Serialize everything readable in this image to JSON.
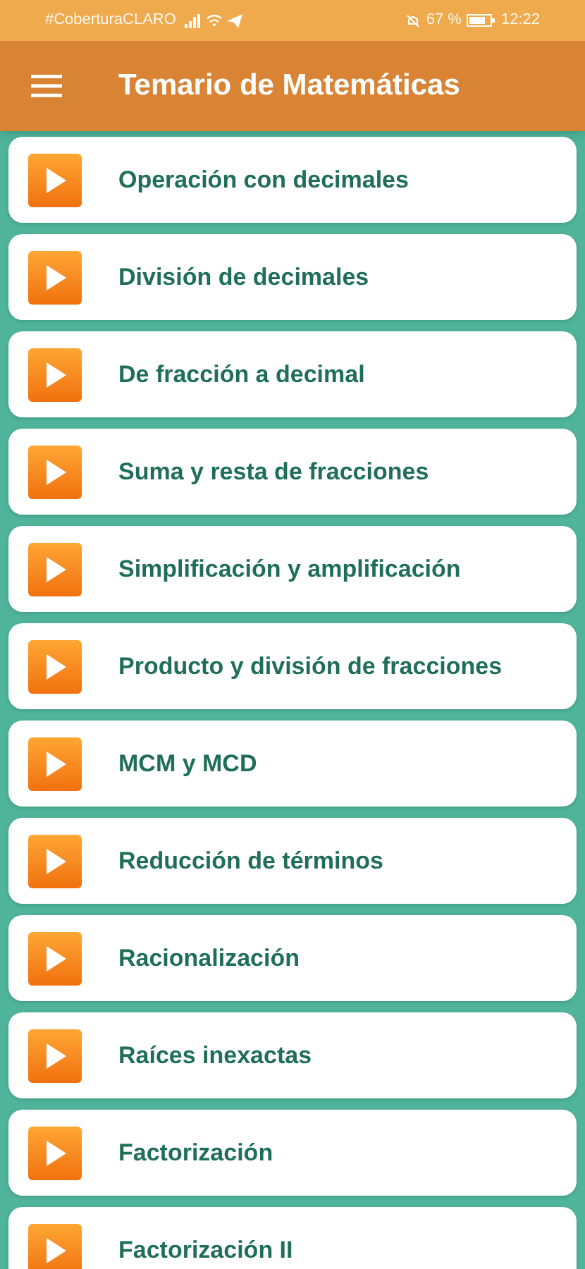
{
  "status_bar": {
    "carrier": "#CoberturaCLARO",
    "battery": "67 %",
    "time": "12:22"
  },
  "app_bar": {
    "title": "Temario de Matemáticas"
  },
  "topics": [
    {
      "label": "Operación con decimales"
    },
    {
      "label": "División de decimales"
    },
    {
      "label": "De fracción a decimal"
    },
    {
      "label": "Suma y resta de fracciones"
    },
    {
      "label": "Simplificación y amplificación"
    },
    {
      "label": "Producto y división de fracciones"
    },
    {
      "label": "MCM y MCD"
    },
    {
      "label": "Reducción de términos"
    },
    {
      "label": "Racionalización"
    },
    {
      "label": "Raíces inexactas"
    },
    {
      "label": "Factorización"
    },
    {
      "label": "Factorización II"
    }
  ]
}
